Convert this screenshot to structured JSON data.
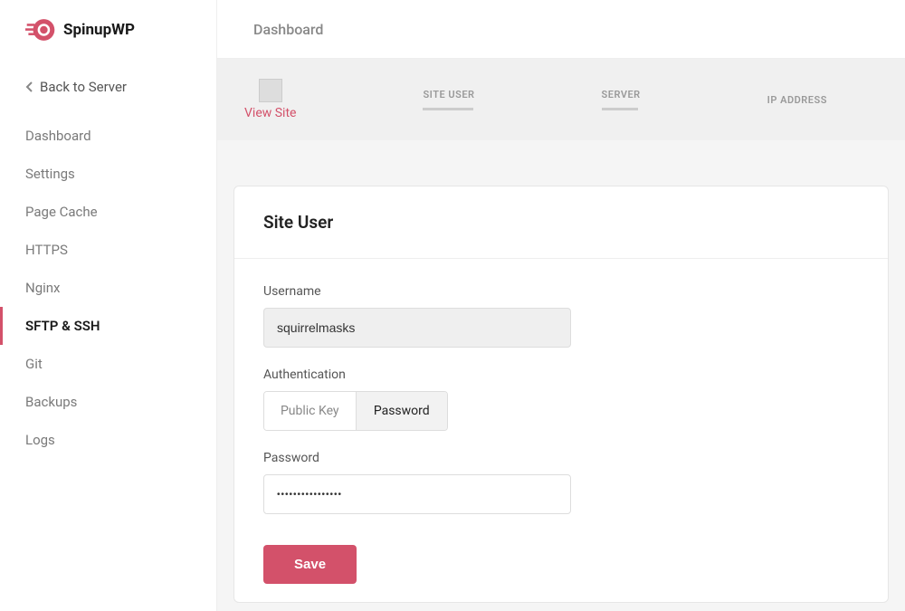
{
  "brand": {
    "name": "SpinupWP"
  },
  "back_link": "Back to Server",
  "nav": {
    "items": [
      {
        "label": "Dashboard"
      },
      {
        "label": "Settings"
      },
      {
        "label": "Page Cache"
      },
      {
        "label": "HTTPS"
      },
      {
        "label": "Nginx"
      },
      {
        "label": "SFTP & SSH"
      },
      {
        "label": "Git"
      },
      {
        "label": "Backups"
      },
      {
        "label": "Logs"
      }
    ],
    "active_index": 5
  },
  "breadcrumb": "Dashboard",
  "info_bar": {
    "view_site": "View Site",
    "cols": [
      "SITE USER",
      "SERVER",
      "IP ADDRESS"
    ]
  },
  "card": {
    "title": "Site User",
    "username_label": "Username",
    "username_value": "squirrelmasks",
    "auth_label": "Authentication",
    "auth_options": [
      "Public Key",
      "Password"
    ],
    "auth_active": 1,
    "password_label": "Password",
    "password_value": "••••••••••••••••",
    "save": "Save"
  }
}
